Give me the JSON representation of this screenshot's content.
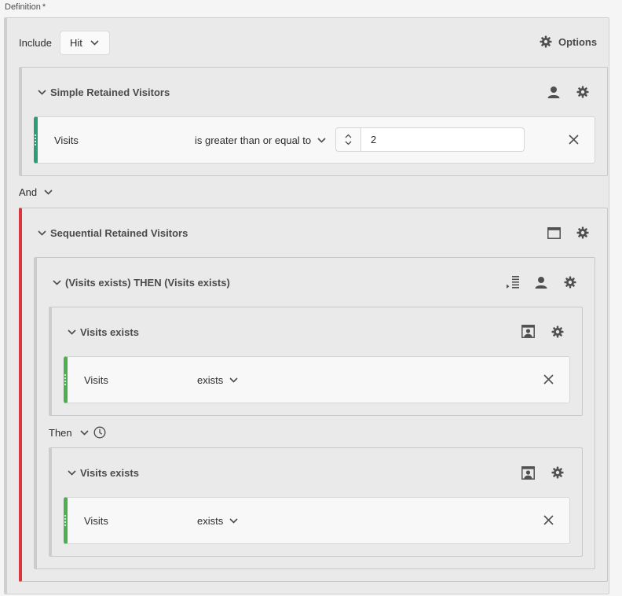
{
  "definition": {
    "label": "Definition",
    "required_mark": "*"
  },
  "include": {
    "label": "Include",
    "value": "Hit"
  },
  "options": {
    "label": "Options"
  },
  "container1": {
    "title": "Simple Retained Visitors",
    "rule": {
      "metric": "Visits",
      "operator": "is greater than or equal to",
      "value": "2"
    }
  },
  "connector": {
    "label": "And"
  },
  "container2": {
    "title": "Sequential Retained Visitors",
    "sequence": {
      "title": "(Visits exists) THEN (Visits exists)",
      "step1": {
        "title": "Visits exists",
        "rule": {
          "metric": "Visits",
          "operator": "exists"
        }
      },
      "then": {
        "label": "Then"
      },
      "step2": {
        "title": "Visits exists",
        "rule": {
          "metric": "Visits",
          "operator": "exists"
        }
      }
    }
  },
  "colors": {
    "include_accent": "#2d9d78",
    "exclude_accent": "#d7373f",
    "rule_handle": "#4cb050"
  }
}
